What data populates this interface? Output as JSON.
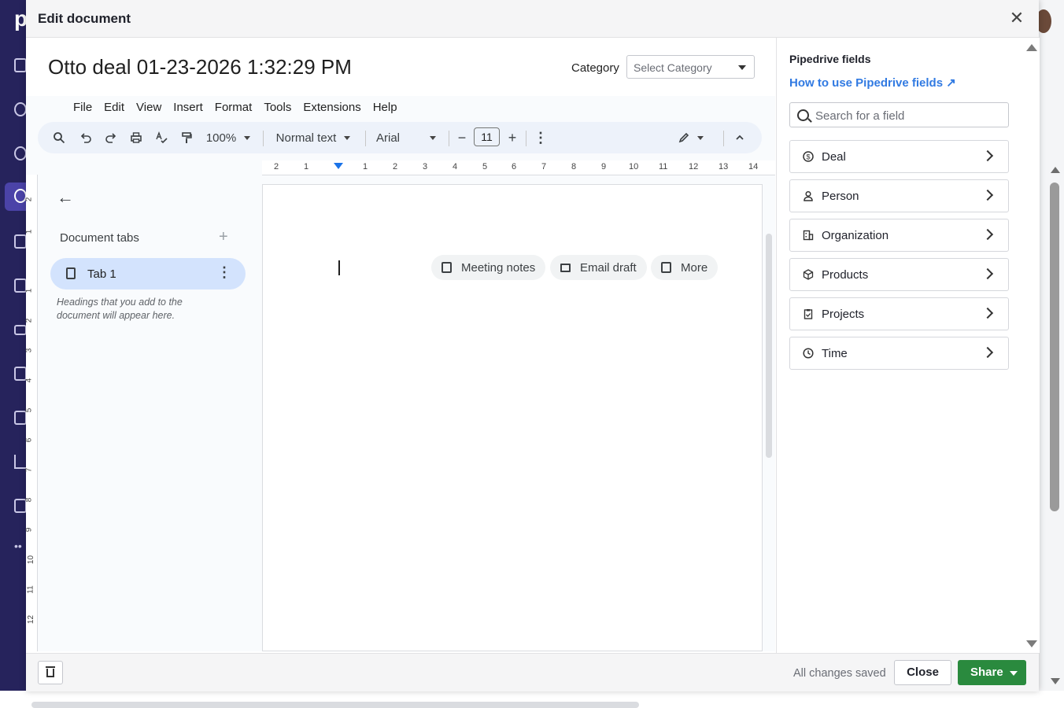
{
  "modal": {
    "title": "Edit document",
    "close_icon": "close-icon"
  },
  "document": {
    "title": "Otto deal 01-23-2026 1:32:29 PM",
    "category_label": "Category",
    "category_value": "Select Category"
  },
  "gdoc": {
    "menus": [
      "File",
      "Edit",
      "View",
      "Insert",
      "Format",
      "Tools",
      "Extensions",
      "Help"
    ],
    "toolbar": {
      "zoom": "100%",
      "style": "Normal text",
      "font": "Arial",
      "font_size": "11",
      "minus": "−",
      "plus": "+"
    },
    "ruler_numbers": [
      "2",
      "1",
      "1",
      "2",
      "3",
      "4",
      "5",
      "6",
      "7",
      "8",
      "9",
      "10",
      "11",
      "12",
      "13",
      "14"
    ],
    "vruler_numbers": [
      "2",
      "1",
      "1",
      "2",
      "3",
      "4",
      "5",
      "6",
      "7",
      "8",
      "9",
      "10",
      "11",
      "12"
    ],
    "outline": {
      "heading": "Document tabs",
      "tab_label": "Tab 1",
      "hint": "Headings that you add to the document will appear here."
    },
    "chips": [
      "Meeting notes",
      "Email draft",
      "More"
    ]
  },
  "fields_panel": {
    "title": "Pipedrive fields",
    "help_link": "How to use Pipedrive fields ↗",
    "search_placeholder": "Search for a field",
    "items": [
      {
        "label": "Deal",
        "icon": "dollar-icon"
      },
      {
        "label": "Person",
        "icon": "person-icon"
      },
      {
        "label": "Organization",
        "icon": "building-icon"
      },
      {
        "label": "Products",
        "icon": "box-icon"
      },
      {
        "label": "Projects",
        "icon": "clipboard-icon"
      },
      {
        "label": "Time",
        "icon": "clock-icon"
      }
    ]
  },
  "footer": {
    "status": "All changes saved",
    "close_label": "Close",
    "share_label": "Share"
  },
  "colors": {
    "accent_link": "#317ae2",
    "share_green": "#2a8a3e",
    "tab_active": "#d3e3fd",
    "sidebar_bg": "#26235c"
  }
}
